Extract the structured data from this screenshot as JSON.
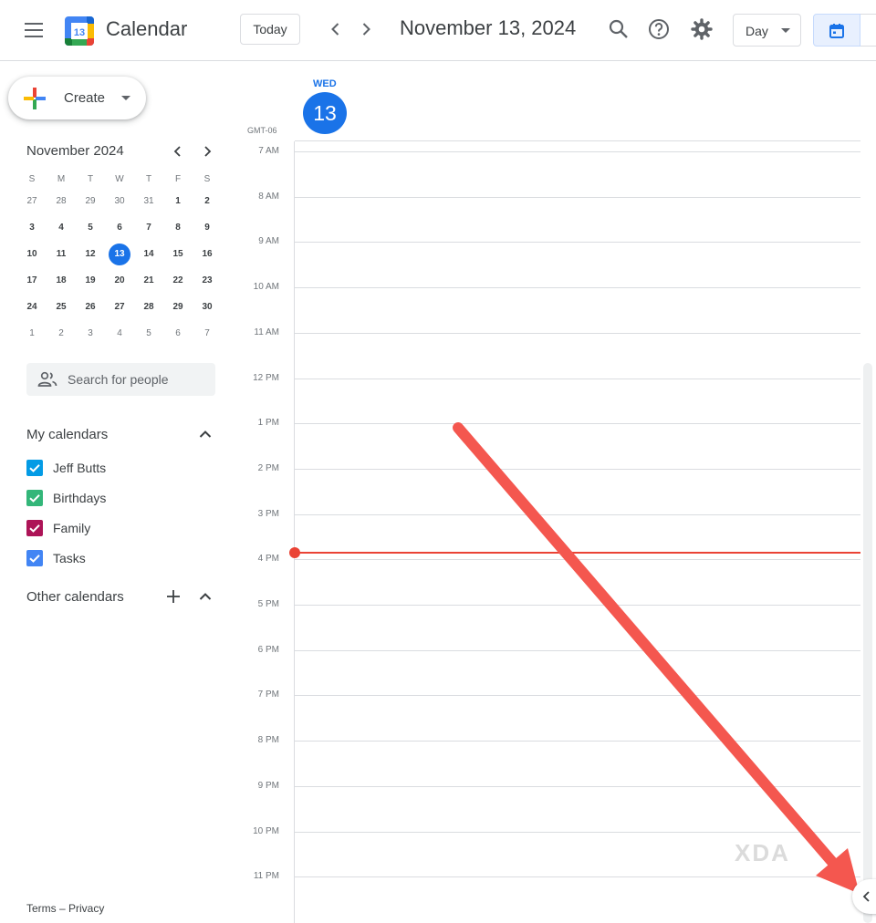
{
  "header": {
    "app_title": "Calendar",
    "logo_day": "13",
    "today_label": "Today",
    "date_title": "November 13, 2024",
    "view_select": "Day"
  },
  "sidebar": {
    "create_label": "Create",
    "mini_calendar": {
      "title": "November 2024",
      "weekdays": [
        "S",
        "M",
        "T",
        "W",
        "T",
        "F",
        "S"
      ],
      "weeks": [
        [
          "27",
          "28",
          "29",
          "30",
          "31",
          "1",
          "2"
        ],
        [
          "3",
          "4",
          "5",
          "6",
          "7",
          "8",
          "9"
        ],
        [
          "10",
          "11",
          "12",
          "13",
          "14",
          "15",
          "16"
        ],
        [
          "17",
          "18",
          "19",
          "20",
          "21",
          "22",
          "23"
        ],
        [
          "24",
          "25",
          "26",
          "27",
          "28",
          "29",
          "30"
        ],
        [
          "1",
          "2",
          "3",
          "4",
          "5",
          "6",
          "7"
        ]
      ],
      "selected": "13"
    },
    "search_people_placeholder": "Search for people",
    "my_calendars_title": "My calendars",
    "my_calendars": [
      {
        "label": "Jeff Butts",
        "color": "#039be5"
      },
      {
        "label": "Birthdays",
        "color": "#33b679"
      },
      {
        "label": "Family",
        "color": "#ad1457"
      },
      {
        "label": "Tasks",
        "color": "#4285f4"
      }
    ],
    "other_calendars_title": "Other calendars",
    "footer": "Terms – Privacy"
  },
  "day_view": {
    "weekday": "WED",
    "day_number": "13",
    "timezone": "GMT-06",
    "hours": [
      "7 AM",
      "8 AM",
      "9 AM",
      "10 AM",
      "11 AM",
      "12 PM",
      "1 PM",
      "2 PM",
      "3 PM",
      "4 PM",
      "5 PM",
      "6 PM",
      "7 PM",
      "8 PM",
      "9 PM",
      "10 PM",
      "11 PM"
    ],
    "now_indicator_color": "#ea4335"
  },
  "overlay": {
    "watermark": "XDA",
    "arrow_color": "#f4574f"
  },
  "colors": {
    "accent": "#1a73e8",
    "grid_line": "#dadce0"
  }
}
